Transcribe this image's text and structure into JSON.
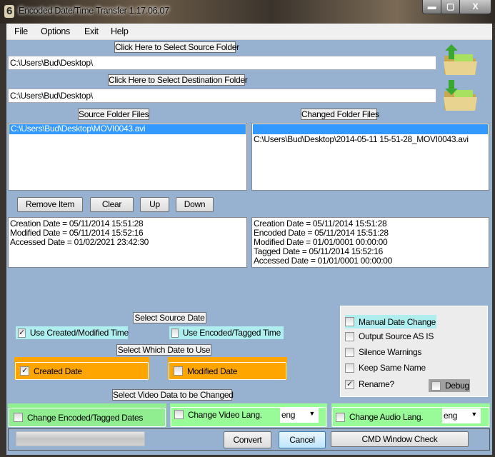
{
  "window": {
    "title": "Encoded Date/Time Transfer 1.17.06.07",
    "min": "▬",
    "max": "▢",
    "close": "X"
  },
  "menu": [
    "File",
    "Options",
    "Exit",
    "Help"
  ],
  "source": {
    "button": "Click Here to Select Source Folder",
    "path": "C:\\Users\\Bud\\Desktop\\"
  },
  "destination": {
    "button": "Click Here to Select Destination Folder",
    "path": "C:\\Users\\Bud\\Desktop\\"
  },
  "lists": {
    "source_label": "Source Folder Files",
    "changed_label": "Changed Folder Files",
    "source_items": [
      "C:\\Users\\Bud\\Desktop\\MOVI0043.avi"
    ],
    "changed_items": [
      "",
      "C:\\Users\\Bud\\Desktop\\2014-05-11 15-51-28_MOVI0043.avi"
    ]
  },
  "list_buttons": [
    "Remove Item",
    "Clear",
    "Up",
    "Down"
  ],
  "source_info": [
    "Creation Date = 05/11/2014 15:51:28",
    "Modified Date = 05/11/2014 15:52:16",
    "Accessed Date = 01/02/2021 23:42:30"
  ],
  "changed_info": [
    "Creation Date = 05/11/2014 15:51:28",
    "Encoded Date = 05/11/2014 15:51:28",
    "Modified Date = 01/01/0001 00:00:00",
    "Tagged Date = 05/11/2014 15:52:16",
    "Accessed Date = 01/01/0001 00:00:00"
  ],
  "source_date": {
    "label": "Select Source Date",
    "use_created": "Use Created/Modified Time",
    "use_created_checked": true,
    "use_encoded": "Use Encoded/Tagged Time",
    "use_encoded_checked": false
  },
  "which_date": {
    "label": "Select Which Date to Use",
    "created": "Created Date",
    "created_checked": true,
    "modified": "Modified Date",
    "modified_checked": false
  },
  "video_data": {
    "label": "Select Video Data to be Changed",
    "change_dates": "Change Encoded/Tagged Dates",
    "change_video_lang": "Change Video Lang.",
    "video_lang": "eng",
    "change_audio_lang": "Change Audio Lang.",
    "audio_lang": "eng"
  },
  "options": {
    "manual": "Manual Date Change",
    "output_as_is": "Output Source AS IS",
    "silence": "Silence Warnings",
    "keep_name": "Keep Same Name",
    "rename": "Rename?",
    "rename_checked": true,
    "debug": "Debug"
  },
  "actions": {
    "convert": "Convert",
    "cancel": "Cancel",
    "cmd_check": "CMD Window Check",
    "progress": 0
  },
  "colors": {
    "background": "#97b2d0",
    "orange": "#ffa500",
    "green": "#98fb98",
    "cyan": "#aeeeee"
  }
}
